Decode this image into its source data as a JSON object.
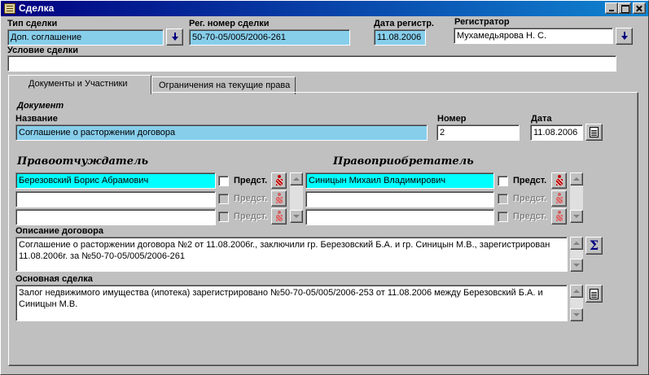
{
  "window": {
    "title": "Сделка"
  },
  "header": {
    "deal_type_label": "Тип сделки",
    "deal_type_value": "Доп. соглашение",
    "reg_number_label": "Рег. номер сделки",
    "reg_number_value": "50-70-05/005/2006-261",
    "reg_date_label": "Дата регистр.",
    "reg_date_value": "11.08.2006",
    "registrar_label": "Регистратор",
    "registrar_value": "Мухамедьярова Н. С.",
    "condition_label": "Условие сделки",
    "condition_value": ""
  },
  "tabs": [
    {
      "label": "Документы и Участники",
      "active": true
    },
    {
      "label": "Ограничения на текущие права",
      "active": false
    }
  ],
  "document": {
    "section_label": "Документ",
    "name_label": "Название",
    "name_value": "Соглашение о расторжении договора",
    "number_label": "Номер",
    "number_value": "2",
    "date_label": "Дата",
    "date_value": "11.08.2006"
  },
  "parties": {
    "grantor_label": "Правоотчуждатель",
    "grantee_label": "Правоприобретатель",
    "pred_label": "Предст.",
    "grantors": [
      "Березовский Борис Абрамович",
      "",
      ""
    ],
    "grantees": [
      "Синицын  Михаил Владимирович",
      "",
      ""
    ]
  },
  "description": {
    "label": "Описание договора",
    "value": "Соглашение о расторжении договора №2 от 11.08.2006г., заключили гр. Березовский Б.А. и гр. Синицын М.В., зарегистрирован 11.08.2006г. за №50-70-05/005/2006-261"
  },
  "main_deal": {
    "label": "Основная сделка",
    "value": "Залог недвижимого имущества (ипотека) зарегистрировано  №50-70-05/005/2006-253 от 11.08.2006 между Березовский Б.А. и Синицын М.В."
  },
  "colors": {
    "title_bar": "#000080",
    "field_blue": "#87ceeb",
    "field_cyan": "#00ffff",
    "face": "#c0c0c0"
  }
}
